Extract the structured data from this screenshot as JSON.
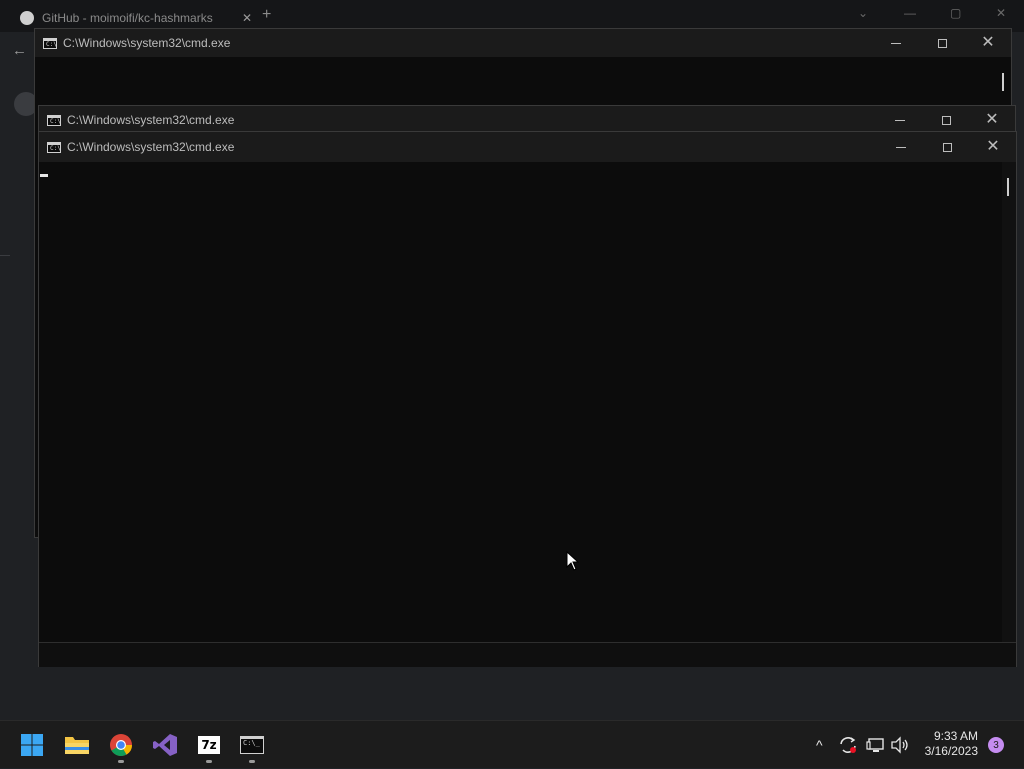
{
  "browser": {
    "tab_title": "GitHub - moimoifi/kc-hashmarks",
    "tab_close": "✕",
    "new_tab": "+",
    "back": "←"
  },
  "windows": [
    {
      "title": "C:\\Windows\\system32\\cmd.exe"
    },
    {
      "title": "C:\\Windows\\system32\\cmd.exe"
    },
    {
      "title": "C:\\Windows\\system32\\cmd.exe"
    }
  ],
  "window_controls": {
    "close": "✕"
  },
  "taskbar": {
    "apps": [
      "windows-start",
      "file-explorer",
      "chrome",
      "visual-studio",
      "7-zip",
      "command-prompt"
    ],
    "sevenzip_label": "7z",
    "cmd_label": "C:\\_",
    "tray_chevron": "^",
    "clock": {
      "time": "9:33 AM",
      "date": "3/16/2023"
    },
    "notification_count": "3"
  },
  "colors": {
    "console_bg": "#0c0c0c",
    "titlebar_bg": "#1b1b1b",
    "taskbar_bg": "#1c1c1c",
    "accent_start": "#3ba7f3",
    "vs_purple": "#8661c5",
    "badge": "#c58cf0"
  }
}
